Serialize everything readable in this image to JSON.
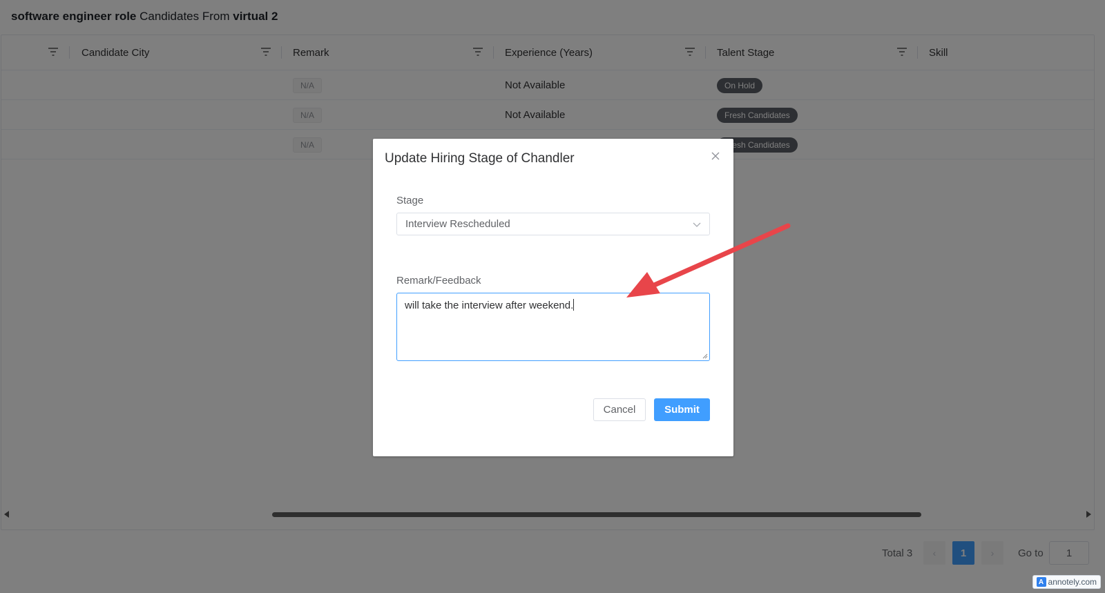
{
  "header": {
    "role": "software engineer role",
    "middle": "Candidates From",
    "source": "virtual 2"
  },
  "table": {
    "columns": [
      "Candidate City",
      "Remark",
      "Experience (Years)",
      "Talent Stage",
      "Skill"
    ],
    "rows": [
      {
        "remark": "N/A",
        "experience": "Not Available",
        "stage": "On Hold"
      },
      {
        "remark": "N/A",
        "experience": "Not Available",
        "stage": "Fresh Candidates"
      },
      {
        "remark": "N/A",
        "experience": "",
        "stage": "Fresh Candidates"
      }
    ]
  },
  "pagination": {
    "total": "Total 3",
    "prev": "‹",
    "current": "1",
    "next": "›",
    "goto_label": "Go to",
    "goto_value": "1"
  },
  "dialog": {
    "title": "Update Hiring Stage of Chandler",
    "stage_label": "Stage",
    "stage_value": "Interview Rescheduled",
    "remark_label": "Remark/Feedback",
    "remark_value": "will take the interview after weekend.",
    "cancel": "Cancel",
    "submit": "Submit"
  },
  "watermark": {
    "badge": "A",
    "text": "annotely.com"
  },
  "colors": {
    "primary": "#409eff",
    "annotation_arrow": "#e8454a",
    "stage_tag": "#5b5f66"
  },
  "icons": [
    "filter-icon",
    "close-icon",
    "chevron-down-icon",
    "resize-handle-icon",
    "scroll-left-icon",
    "scroll-right-icon"
  ]
}
